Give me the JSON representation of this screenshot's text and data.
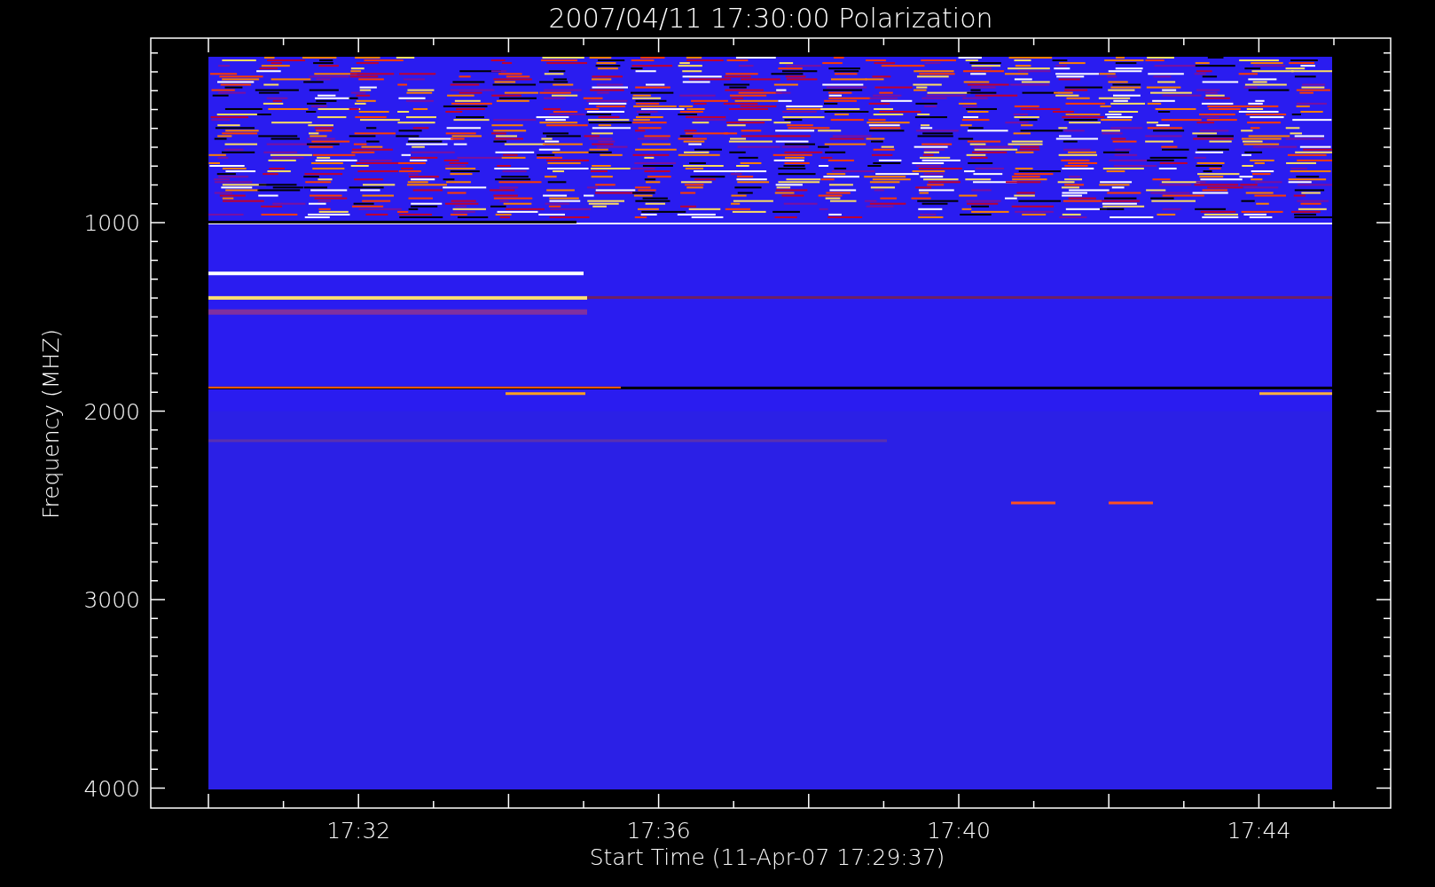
{
  "plot": {
    "title": "2007/04/11 17:30:00 Polarization",
    "ylabel": "Frequency (MHZ)",
    "xlabel": "Start Time (11-Apr-07 17:29:37)",
    "yticks": [
      {
        "label": "1000"
      },
      {
        "label": "2000"
      },
      {
        "label": "3000"
      },
      {
        "label": "4000"
      }
    ],
    "xticks": [
      {
        "label": "17:32"
      },
      {
        "label": "17:36"
      },
      {
        "label": "17:40"
      },
      {
        "label": "17:44"
      }
    ]
  }
}
